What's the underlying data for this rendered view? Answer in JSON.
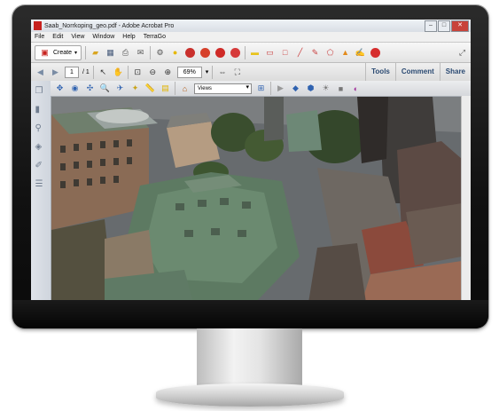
{
  "window": {
    "title": "Saab_Norrkoping_geo.pdf - Adobe Acrobat Pro"
  },
  "menu": [
    "File",
    "Edit",
    "View",
    "Window",
    "Help",
    "TerraGo"
  ],
  "toolbar": {
    "create_label": "Create"
  },
  "nav": {
    "page_current": "1",
    "page_total": "/ 1",
    "zoom": "69%"
  },
  "panels": {
    "tools": "Tools",
    "comment": "Comment",
    "share": "Share"
  },
  "viewtoolbar": {
    "views_label": "Views"
  },
  "colors": {
    "accent": "#2b4a72",
    "close_button": "#c8433a"
  }
}
